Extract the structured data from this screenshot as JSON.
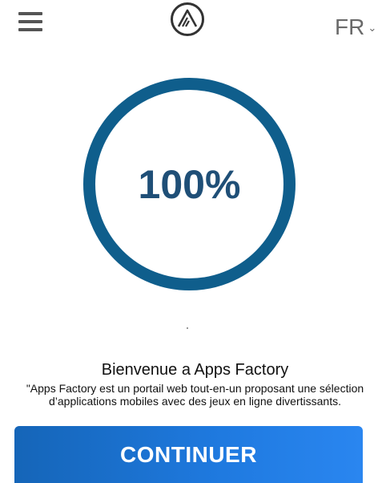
{
  "header": {
    "menu_icon": "hamburger-icon",
    "logo_icon": "apps-factory-logo",
    "language": "FR",
    "language_icon": "chevron-down-icon"
  },
  "progress": {
    "value": 1.0,
    "label": "100%",
    "ring_color": "#0f5e8c",
    "label_color": "#1f4f77"
  },
  "welcome": {
    "title": "Bienvenue a Apps Factory",
    "description": "\"Apps Factory est un portail web tout-en-un proposant une sélection d’applications mobiles avec des jeux en ligne divertissants."
  },
  "cta": {
    "label": "CONTINUER",
    "color": "#1f7ae0"
  }
}
